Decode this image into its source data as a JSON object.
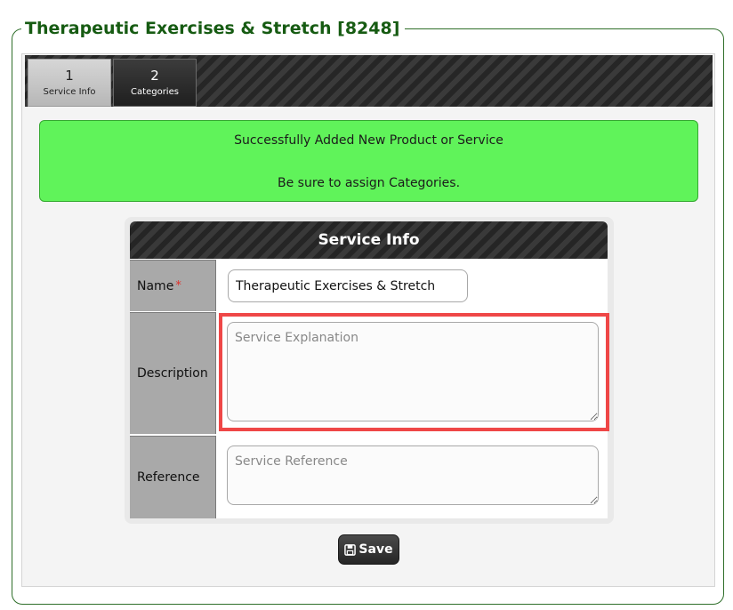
{
  "page": {
    "title": "Therapeutic Exercises & Stretch [8248]"
  },
  "tabs": [
    {
      "number": "1",
      "label": "Service Info",
      "active": true
    },
    {
      "number": "2",
      "label": "Categories",
      "active": false
    }
  ],
  "alert": {
    "line1": "Successfully Added New Product or Service",
    "line2": "Be sure to assign Categories."
  },
  "form": {
    "header": "Service Info",
    "name_label": "Name",
    "required_mark": "*",
    "name_value": "Therapeutic Exercises & Stretch",
    "description_label": "Description",
    "description_placeholder": "Service Explanation",
    "reference_label": "Reference",
    "reference_placeholder": "Service Reference",
    "save_label": "Save"
  },
  "colors": {
    "legend_green": "#165b12",
    "alert_green": "#60f35a",
    "highlight_red": "#ef4747"
  },
  "icons": {
    "save": "floppy-disk-icon"
  }
}
